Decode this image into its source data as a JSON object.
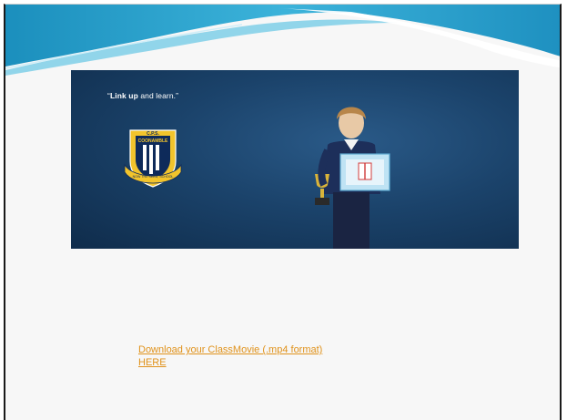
{
  "banner": {
    "quote_open": "“",
    "quote_bold": "Link up",
    "quote_rest": " and learn.”",
    "crest_text_top": "C.P.S.",
    "crest_text_middle": "COONAMBLE",
    "crest_text_bottom": "NOW THE SEED, SCHOOL"
  },
  "download": {
    "line1": "Download your ClassMovie (.mp4 format)",
    "line2": "HERE"
  },
  "colors": {
    "link": "#e0921b",
    "banner_bg": "#1b436b",
    "wave": "#2a9fc9"
  }
}
